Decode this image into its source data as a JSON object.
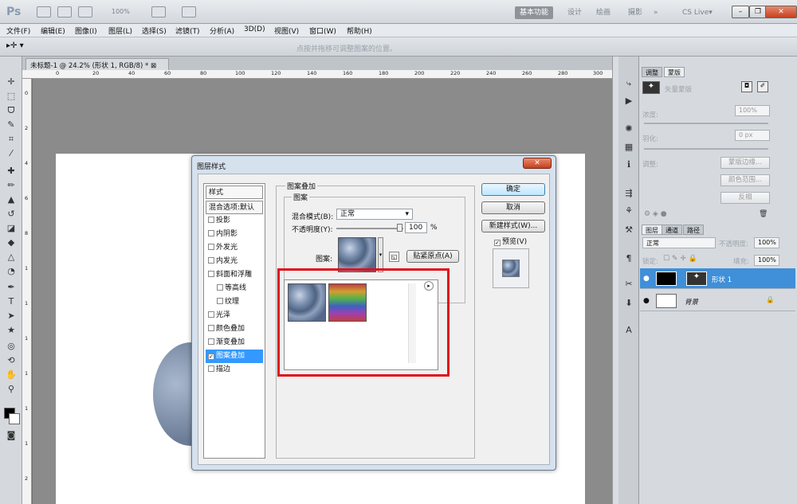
{
  "app": {
    "logo": "Ps",
    "zoom": "100%",
    "hint": "点按并拖移可调整图案的位置。"
  },
  "workspaces": [
    "基本功能",
    "设计",
    "绘画",
    "摄影",
    "»",
    "CS Live▾"
  ],
  "window_buttons": [
    "–",
    "❐",
    "✕"
  ],
  "menu": [
    "文件(F)",
    "编辑(E)",
    "图像(I)",
    "图层(L)",
    "选择(S)",
    "滤镜(T)",
    "分析(A)",
    "3D(D)",
    "视图(V)",
    "窗口(W)",
    "帮助(H)"
  ],
  "document": {
    "tab_title": "未标题-1 @ 24.2% (形状 1, RGB/8) *",
    "tab_close": "⊠"
  },
  "ruler_h": [
    "0",
    "20",
    "40",
    "60",
    "80",
    "100",
    "120",
    "140",
    "160",
    "180",
    "200",
    "220",
    "240",
    "260",
    "280",
    "300"
  ],
  "ruler_v": [
    "0",
    "2",
    "4",
    "6",
    "8",
    "1",
    "1",
    "1",
    "1",
    "1",
    "1",
    "2"
  ],
  "masks_panel": {
    "tabs": [
      "调整",
      "蒙版"
    ],
    "vector_mask": "矢量蒙版",
    "density_label": "浓度:",
    "density_value": "100%",
    "feather_label": "羽化:",
    "feather_value": "0 px",
    "refine_label": "调整:",
    "btn_mask_edge": "蒙版边缘...",
    "btn_color_range": "颜色范围...",
    "btn_invert": "反相"
  },
  "layers_panel": {
    "tabs": [
      "图层",
      "通道",
      "路径"
    ],
    "blend_mode": "正常",
    "opacity_label": "不透明度:",
    "opacity_value": "100%",
    "lock_label": "锁定:",
    "fill_label": "填充:",
    "fill_value": "100%",
    "layers": [
      {
        "name": "形状 1",
        "selected": true
      },
      {
        "name": "背景",
        "selected": false
      }
    ]
  },
  "dialog": {
    "title": "图层样式",
    "close": "✕",
    "styles_header": "样式",
    "styles": [
      {
        "label": "混合选项:默认",
        "checkbox": false,
        "checked": false,
        "indent": 0
      },
      {
        "label": "投影",
        "checkbox": true,
        "checked": false,
        "indent": 0
      },
      {
        "label": "内阴影",
        "checkbox": true,
        "checked": false,
        "indent": 0
      },
      {
        "label": "外发光",
        "checkbox": true,
        "checked": false,
        "indent": 0
      },
      {
        "label": "内发光",
        "checkbox": true,
        "checked": false,
        "indent": 0
      },
      {
        "label": "斜面和浮雕",
        "checkbox": true,
        "checked": false,
        "indent": 0
      },
      {
        "label": "等高线",
        "checkbox": true,
        "checked": false,
        "indent": 1
      },
      {
        "label": "纹理",
        "checkbox": true,
        "checked": false,
        "indent": 1
      },
      {
        "label": "光泽",
        "checkbox": true,
        "checked": false,
        "indent": 0
      },
      {
        "label": "颜色叠加",
        "checkbox": true,
        "checked": false,
        "indent": 0
      },
      {
        "label": "渐变叠加",
        "checkbox": true,
        "checked": false,
        "indent": 0
      },
      {
        "label": "图案叠加",
        "checkbox": true,
        "checked": true,
        "indent": 0,
        "selected": true
      },
      {
        "label": "描边",
        "checkbox": true,
        "checked": false,
        "indent": 0
      }
    ],
    "section_title": "图案叠加",
    "group_title": "图案",
    "blend_label": "混合模式(B):",
    "blend_value": "正常",
    "opacity_label": "不透明度(Y):",
    "opacity_value": "100",
    "opacity_unit": "%",
    "pattern_label": "图案:",
    "snap_button": "贴紧原点(A)",
    "ok": "确定",
    "cancel": "取消",
    "new_style": "新建样式(W)...",
    "preview_label": "预览(V)",
    "preview_checked": true
  },
  "colors": {
    "selection": "#3f8fd9",
    "highlight_box": "#e0101a",
    "list_select": "#3399ff"
  }
}
